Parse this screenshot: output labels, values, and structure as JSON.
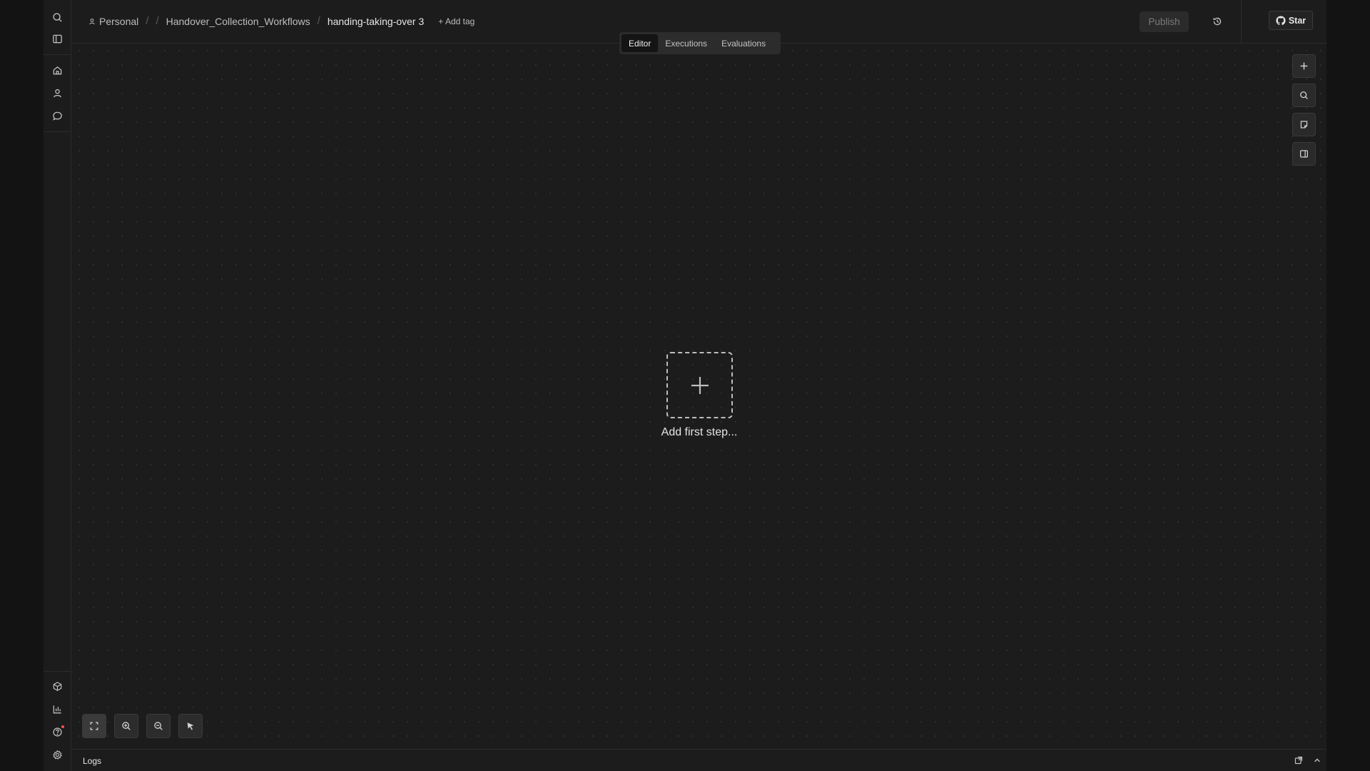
{
  "breadcrumb": {
    "owner": "Personal",
    "separator": "/",
    "folder": "Handover_Collection_Workflows",
    "workflow_name": "handing-taking-over 3",
    "add_tag": "+ Add tag"
  },
  "header": {
    "publish_label": "Publish",
    "star_label": "Star"
  },
  "tabs": [
    {
      "label": "Editor",
      "active": true
    },
    {
      "label": "Executions",
      "active": false
    },
    {
      "label": "Evaluations",
      "active": false
    }
  ],
  "canvas": {
    "empty_state_label": "Add first step..."
  },
  "logs": {
    "label": "Logs"
  },
  "icons": {
    "sidebar_top": [
      "search-icon",
      "panel-toggle-icon",
      "home-icon",
      "user-icon",
      "chat-icon"
    ],
    "sidebar_bottom": [
      "package-icon",
      "bar-chart-icon",
      "help-icon",
      "settings-icon"
    ],
    "right_tools": [
      "plus-icon",
      "search-icon",
      "sticky-note-icon",
      "panel-icon"
    ],
    "bottom_tools": [
      "fit-view-icon",
      "zoom-in-icon",
      "zoom-out-icon",
      "pointer-icon"
    ]
  },
  "colors": {
    "background": "#1c1c1c",
    "notification_dot": "#ef5350"
  }
}
